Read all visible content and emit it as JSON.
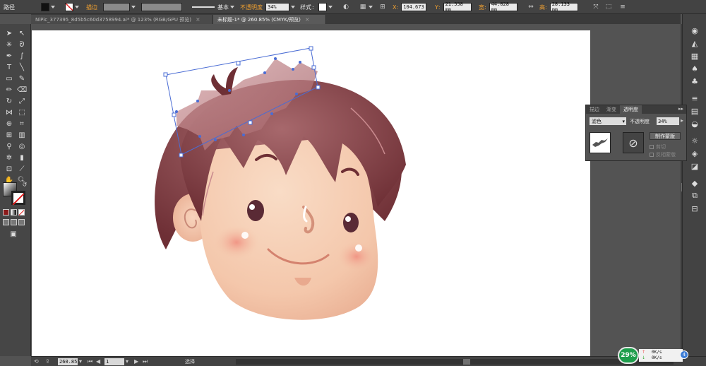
{
  "control_bar": {
    "selection_type": "路径",
    "stroke_label": "描边",
    "brush_label": "基本",
    "opacity_label": "不透明度",
    "opacity_value": "34%",
    "style_label": "样式",
    "x_label": "X",
    "x_value": "104.673",
    "y_label": "Y",
    "y_value": "21.558 mm",
    "width_label": "宽",
    "width_value": "44.028 mm",
    "height_label": "高",
    "height_value": "28.133 mm"
  },
  "tabs": [
    {
      "label": "NiPic_377395_8d5b5c60d3758994.ai* @ 123% (RGB/GPU 预览)",
      "close": "×"
    },
    {
      "label": "未标题-1* @ 260.85% (CMYK/预览)",
      "close": "×"
    }
  ],
  "transparency_panel": {
    "tabs": [
      "描边",
      "渐变",
      "透明度"
    ],
    "menu": "▸▸",
    "blend_mode": "滤色",
    "opacity_label": "不透明度",
    "opacity_value": "34%",
    "make_mask_button": "制作蒙版",
    "clip_label": "剪切",
    "invert_label": "反相蒙版"
  },
  "status_bar": {
    "zoom": "260.85",
    "artboard_number": "1",
    "tool_name": "选择"
  },
  "network_widget": {
    "percent": "29%",
    "up_rate": "0K/s",
    "down_rate": "0K/s",
    "badge": "4"
  },
  "colors": {
    "hair_dark": "#6e2f35",
    "hair_light": "#a7686c",
    "skin": "#f7d2bb",
    "cheek": "#f0a090",
    "accent_orange": "#f0a030"
  }
}
